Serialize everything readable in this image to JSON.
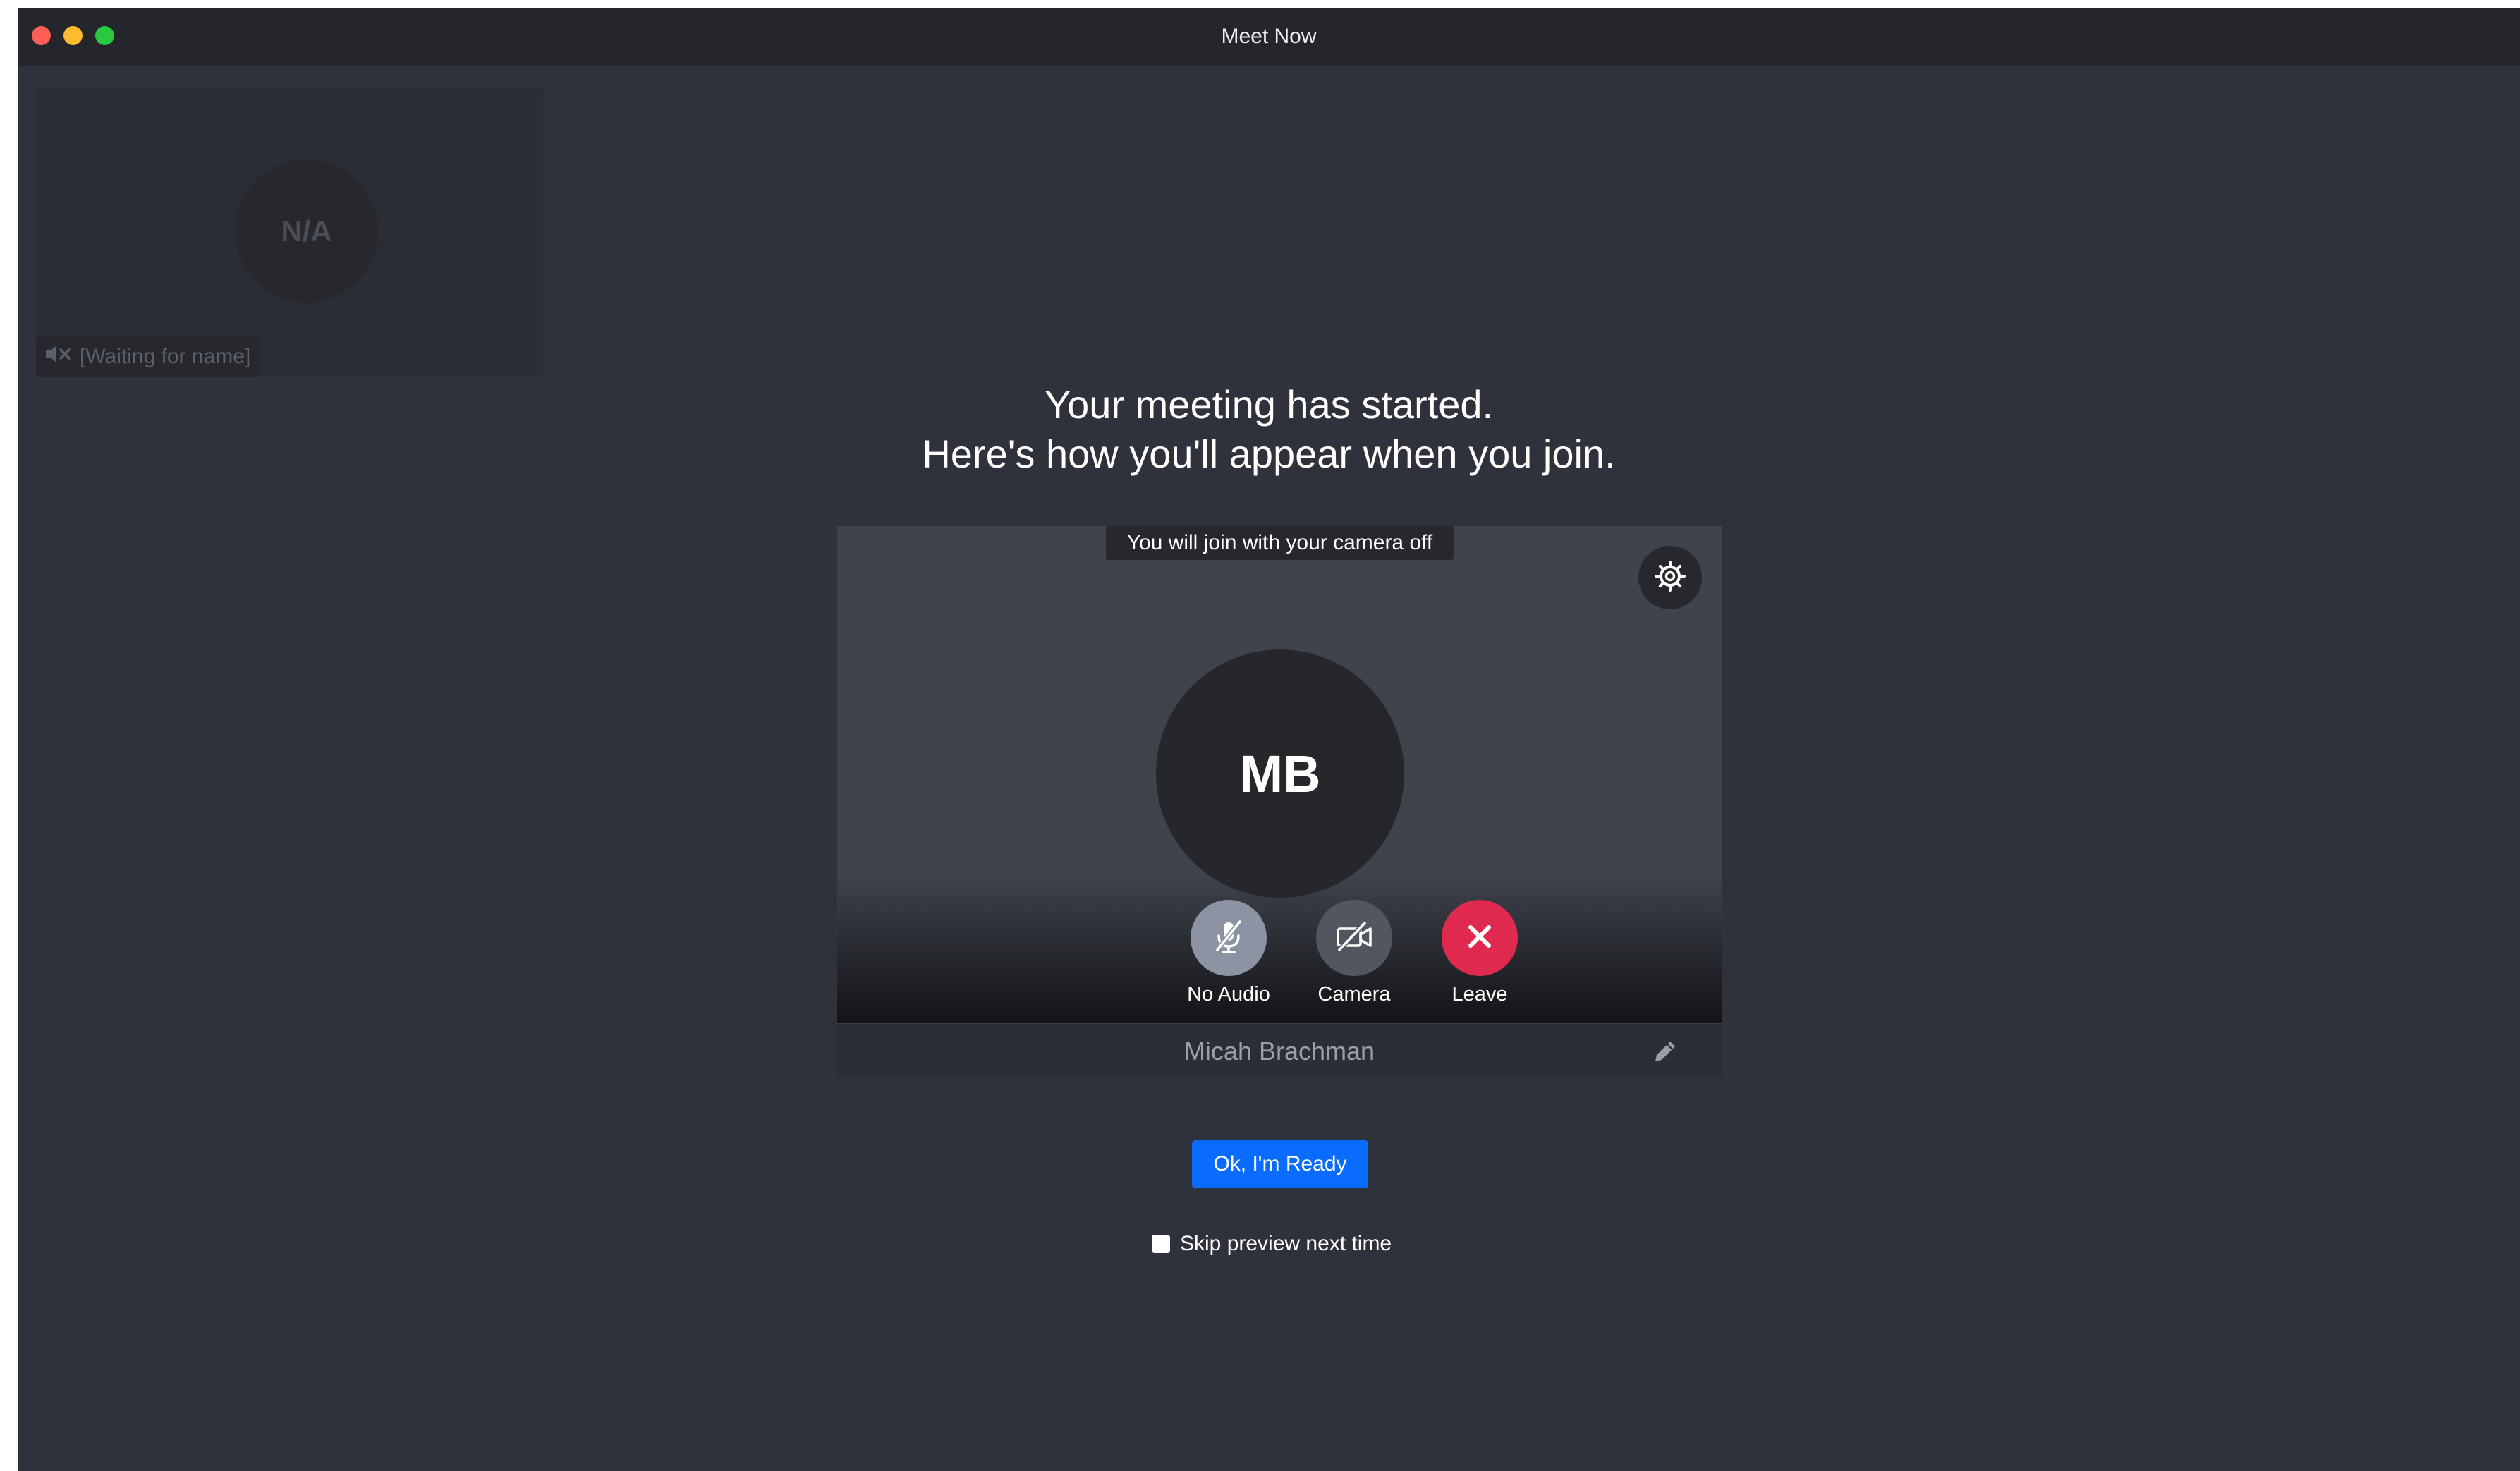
{
  "window": {
    "title": "Meet Now"
  },
  "tile": {
    "avatar_initials": "N/A",
    "name_label": "[Waiting for name]",
    "mic_icon": "speaker-muted-icon"
  },
  "heading": {
    "line1": "Your meeting has started.",
    "line2": "Here's how you'll appear when you join."
  },
  "preview": {
    "camera_off_note": "You will join with your camera off",
    "avatar_initials": "MB",
    "settings_icon": "gear-icon",
    "controls": [
      {
        "label": "No Audio",
        "icon": "mic-off-icon"
      },
      {
        "label": "Camera",
        "icon": "camera-off-icon"
      },
      {
        "label": "Leave",
        "icon": "close-icon"
      }
    ],
    "user_name": "Micah Brachman",
    "edit_icon": "pencil-icon"
  },
  "ready_button": "Ok, I'm Ready",
  "skip_preview": {
    "label": "Skip preview next time",
    "checked": false
  },
  "colors": {
    "accent": "#0a6cff",
    "leave": "#e0294f",
    "background": "#2f323a"
  }
}
